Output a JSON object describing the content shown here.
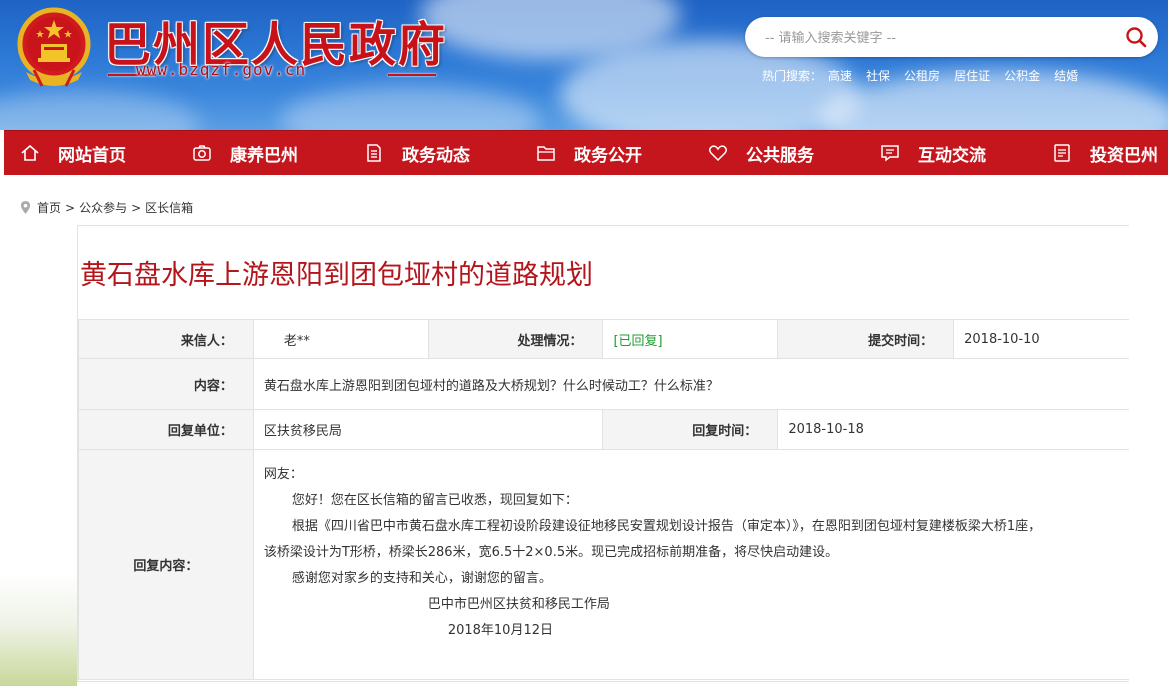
{
  "header": {
    "site_title": "巴州区人民政府",
    "domain": "www.bzqzf.gov.cn",
    "search_placeholder": "-- 请输入搜索关键字 --",
    "hot_label": "热门搜索：",
    "hot_items": [
      "高速",
      "社保",
      "公租房",
      "居住证",
      "公积金",
      "结婚"
    ]
  },
  "nav": {
    "items": [
      {
        "label": "网站首页",
        "icon": "home-icon"
      },
      {
        "label": "康养巴州",
        "icon": "camera-icon"
      },
      {
        "label": "政务动态",
        "icon": "document-icon"
      },
      {
        "label": "政务公开",
        "icon": "folder-icon"
      },
      {
        "label": "公共服务",
        "icon": "heart-icon"
      },
      {
        "label": "互动交流",
        "icon": "chat-icon"
      },
      {
        "label": "投资巴州",
        "icon": "list-icon"
      }
    ]
  },
  "breadcrumb": {
    "icon": "location-pin-icon",
    "items": [
      "首页",
      "公众参与",
      "区长信箱"
    ],
    "separator": ">"
  },
  "article": {
    "title": "黄石盘水库上游恩阳到团包垭村的道路规划",
    "sender_label": "来信人：",
    "sender": "老**",
    "status_label": "处理情况：",
    "status": "[已回复]",
    "submit_time_label": "提交时间：",
    "submit_time": "2018-10-10",
    "content_label": "内容：",
    "content": "黄石盘水库上游恩阳到团包垭村的道路及大桥规划？什么时候动工？什么标准？",
    "reply_unit_label": "回复单位：",
    "reply_unit": "区扶贫移民局",
    "reply_time_label": "回复时间：",
    "reply_time": "2018-10-18",
    "reply_content_label": "回复内容：",
    "reply": {
      "greeting": "网友：",
      "line1": "您好！您在区长信箱的留言已收悉，现回复如下：",
      "line2": "根据《四川省巴中市黄石盘水库工程初设阶段建设征地移民安置规划设计报告（审定本）》，在恩阳到团包垭村复建楼板梁大桥1座，",
      "line3": "该桥梁设计为T形桥，桥梁长286米，宽6.5十2×0.5米。现已完成招标前期准备，将尽快启动建设。",
      "line4": "感谢您对家乡的支持和关心，谢谢您的留言。",
      "signature": "巴中市巴州区扶贫和移民工作局",
      "date": "2018年10月12日"
    }
  },
  "colors": {
    "brand_red": "#c5151d",
    "title_red": "#b3151b",
    "status_green": "#1e9c2f",
    "label_bg": "#f4f4f4",
    "header_blue": "#2d79d6"
  }
}
